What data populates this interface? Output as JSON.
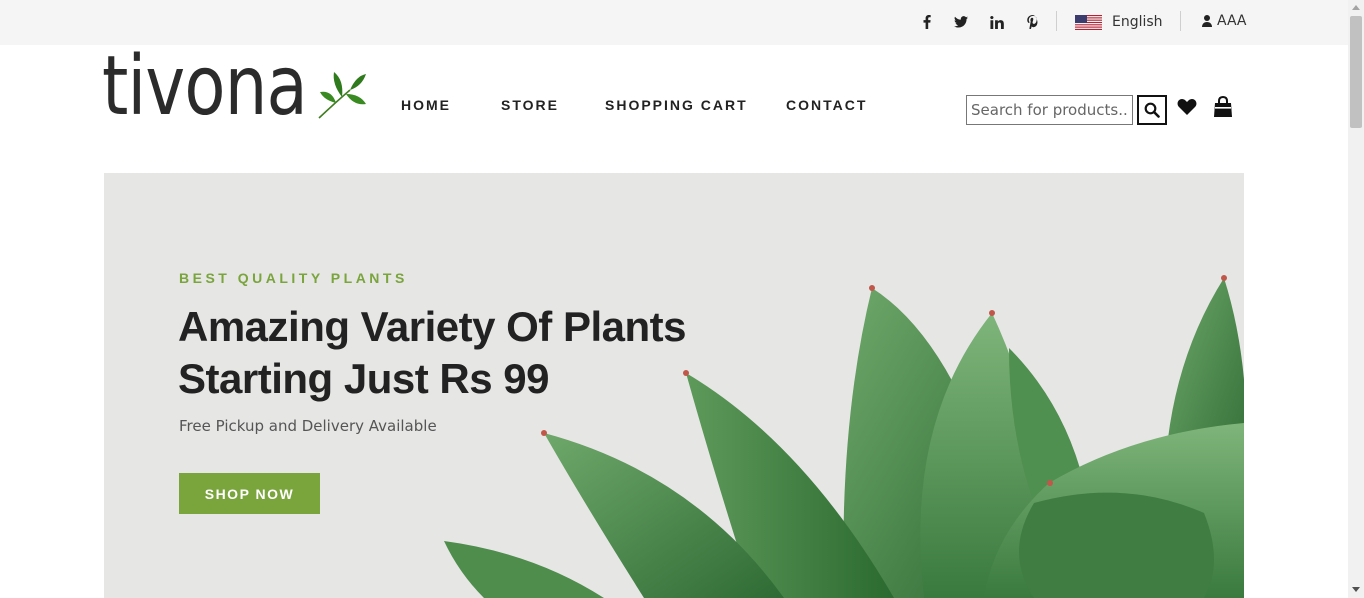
{
  "topbar": {
    "social": [
      "facebook-icon",
      "twitter-icon",
      "linkedin-icon",
      "pinterest-icon"
    ],
    "language": "English",
    "user_name": "AAA"
  },
  "header": {
    "logo_text": "tivona",
    "nav": {
      "home": "HOME",
      "store": "STORE",
      "cart": "SHOPPING CART",
      "contact": "CONTACT"
    },
    "search_placeholder": "Search for products...",
    "icons": [
      "search-icon",
      "heart-icon",
      "shopping-bag-icon"
    ]
  },
  "hero": {
    "subtitle": "BEST QUALITY PLANTS",
    "title_line1": "Amazing Variety Of Plants",
    "title_line2": "Starting Just Rs 99",
    "description": "Free Pickup and Delivery Available",
    "cta": "SHOP NOW"
  },
  "colors": {
    "accent": "#7aa43c",
    "topbar_bg": "#f5f5f5",
    "hero_bg": "#e6e6e5",
    "text_dark": "#222222"
  }
}
